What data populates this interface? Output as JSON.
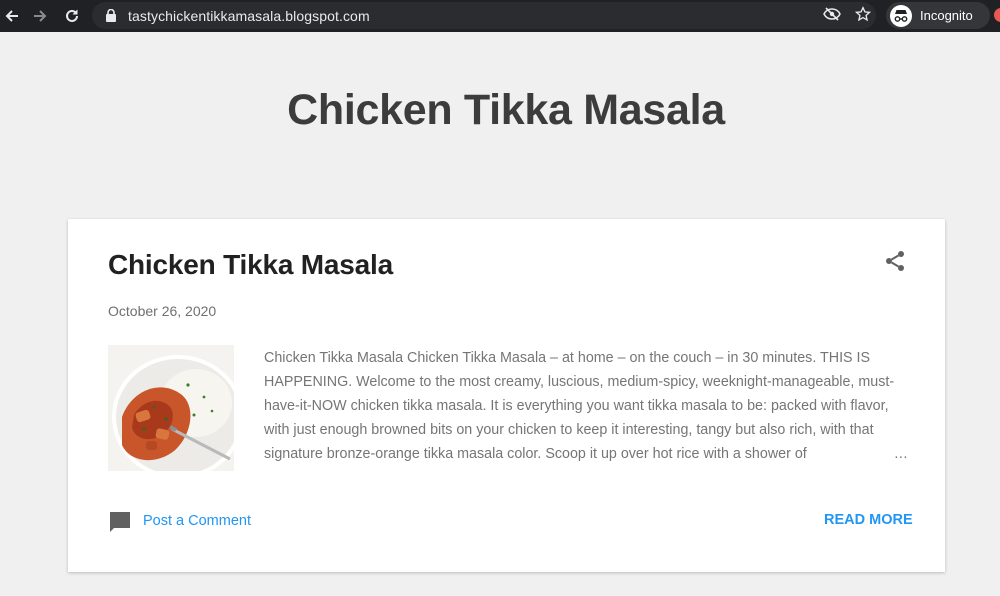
{
  "browser": {
    "url": "tastychickentikkamasala.blogspot.com",
    "incognito_label": "Incognito",
    "icons": [
      "back-arrow-icon",
      "forward-arrow-icon",
      "reload-icon",
      "lock-icon",
      "eye-off-icon",
      "star-icon",
      "incognito-icon"
    ]
  },
  "blog": {
    "title": "Chicken Tikka Masala"
  },
  "post": {
    "title": "Chicken Tikka Masala",
    "date": "October 26, 2020",
    "snippet": "Chicken Tikka Masala Chicken Tikka Masala – at home – on the couch – in 30 minutes. THIS IS HAPPENING. Welcome to the most creamy, luscious, medium-spicy, weeknight-manageable, must-have-it-NOW chicken tikka masala. It is everything you want tikka masala to be: packed with flavor, with just enough browned bits on your chicken to keep it interesting, tangy but also rich, with that signature bronze-orange tikka masala color. Scoop it up over hot rice with a shower of",
    "ellipsis": "…",
    "comment_label": "Post a Comment",
    "read_more_label": "READ MORE"
  },
  "colors": {
    "chrome": "#202124",
    "link": "#2196f3",
    "page_bg": "#f0f0f0"
  }
}
